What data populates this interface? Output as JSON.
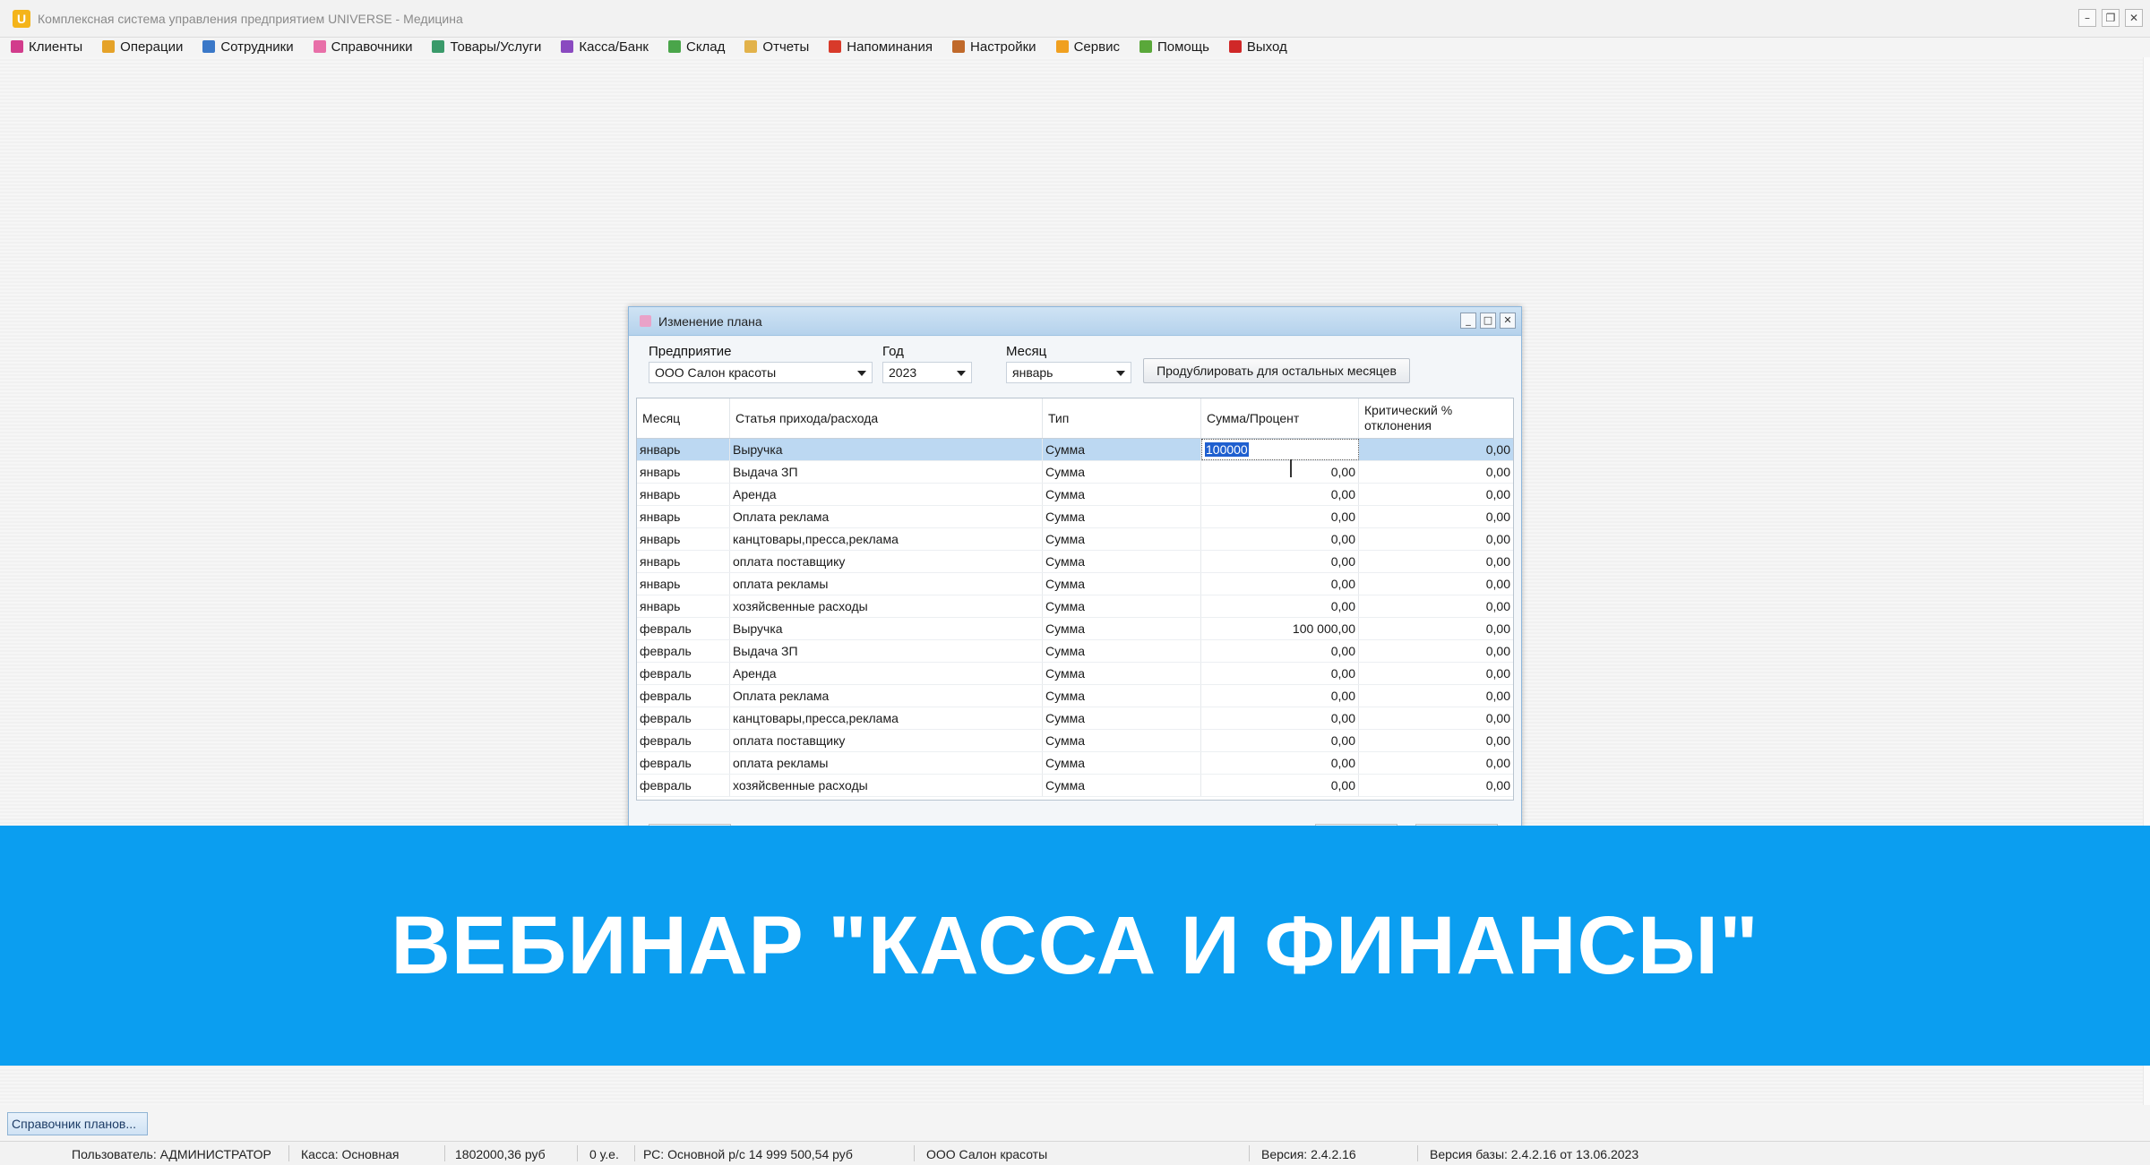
{
  "window": {
    "title": "Комплексная система управления предприятием UNIVERSE - Медицина",
    "logo_letter": "U",
    "controls": [
      "–",
      "❐",
      "✕"
    ]
  },
  "menu": [
    {
      "label": "Клиенты",
      "icon": "clients-icon",
      "color": "#d23c8c"
    },
    {
      "label": "Операции",
      "icon": "operations-icon",
      "color": "#e5a228"
    },
    {
      "label": "Сотрудники",
      "icon": "employees-icon",
      "color": "#3a78c8"
    },
    {
      "label": "Справочники",
      "icon": "directories-icon",
      "color": "#e86fa8"
    },
    {
      "label": "Товары/Услуги",
      "icon": "goods-services-icon",
      "color": "#3a9a6a"
    },
    {
      "label": "Касса/Банк",
      "icon": "cash-bank-icon",
      "color": "#8a4ac0"
    },
    {
      "label": "Склад",
      "icon": "warehouse-icon",
      "color": "#4aa54a"
    },
    {
      "label": "Отчеты",
      "icon": "reports-icon",
      "color": "#e2b24a"
    },
    {
      "label": "Напоминания",
      "icon": "reminders-icon",
      "color": "#d83a2a"
    },
    {
      "label": "Настройки",
      "icon": "settings-icon",
      "color": "#c0692a"
    },
    {
      "label": "Сервис",
      "icon": "service-icon",
      "color": "#f0a020"
    },
    {
      "label": "Помощь",
      "icon": "help-icon",
      "color": "#5aa83a"
    },
    {
      "label": "Выход",
      "icon": "exit-icon",
      "color": "#d02828"
    }
  ],
  "dialog": {
    "title": "Изменение плана",
    "controls": [
      "_",
      "□",
      "✕"
    ],
    "enterprise_label": "Предприятие",
    "enterprise_value": "ООО Салон красоты",
    "year_label": "Год",
    "year_value": "2023",
    "month_label": "Месяц",
    "month_value": "январь",
    "duplicate_button": "Продублировать для остальных месяцев",
    "columns": [
      "Месяц",
      "Статья прихода/расхода",
      "Тип",
      "Сумма/Процент",
      "Критический % отклонения"
    ],
    "rows": [
      {
        "month": "январь",
        "item": "Выручка",
        "type": "Сумма",
        "amount": "100000",
        "critical": "0,00",
        "selected": true
      },
      {
        "month": "январь",
        "item": "Выдача ЗП",
        "type": "Сумма",
        "amount": "0,00",
        "critical": "0,00"
      },
      {
        "month": "январь",
        "item": "Аренда",
        "type": "Сумма",
        "amount": "0,00",
        "critical": "0,00"
      },
      {
        "month": "январь",
        "item": "Оплата реклама",
        "type": "Сумма",
        "amount": "0,00",
        "critical": "0,00"
      },
      {
        "month": "январь",
        "item": "канцтовары,пресса,реклама",
        "type": "Сумма",
        "amount": "0,00",
        "critical": "0,00"
      },
      {
        "month": "январь",
        "item": "оплата поставщику",
        "type": "Сумма",
        "amount": "0,00",
        "critical": "0,00"
      },
      {
        "month": "январь",
        "item": "оплата рекламы",
        "type": "Сумма",
        "amount": "0,00",
        "critical": "0,00"
      },
      {
        "month": "январь",
        "item": "хозяйсвенные расходы",
        "type": "Сумма",
        "amount": "0,00",
        "critical": "0,00"
      },
      {
        "month": "февраль",
        "item": "Выручка",
        "type": "Сумма",
        "amount": "100 000,00",
        "critical": "0,00"
      },
      {
        "month": "февраль",
        "item": "Выдача ЗП",
        "type": "Сумма",
        "amount": "0,00",
        "critical": "0,00"
      },
      {
        "month": "февраль",
        "item": "Аренда",
        "type": "Сумма",
        "amount": "0,00",
        "critical": "0,00"
      },
      {
        "month": "февраль",
        "item": "Оплата реклама",
        "type": "Сумма",
        "amount": "0,00",
        "critical": "0,00"
      },
      {
        "month": "февраль",
        "item": "канцтовары,пресса,реклама",
        "type": "Сумма",
        "amount": "0,00",
        "critical": "0,00"
      },
      {
        "month": "февраль",
        "item": "оплата поставщику",
        "type": "Сумма",
        "amount": "0,00",
        "critical": "0,00"
      },
      {
        "month": "февраль",
        "item": "оплата рекламы",
        "type": "Сумма",
        "amount": "0,00",
        "critical": "0,00"
      },
      {
        "month": "февраль",
        "item": "хозяйсвенные расходы",
        "type": "Сумма",
        "amount": "0,00",
        "critical": "0,00"
      }
    ]
  },
  "banner": {
    "text": "ВЕБИНАР \"КАССА И ФИНАНСЫ\"",
    "color": "#0b9ef0"
  },
  "taskbar": {
    "item": "Справочник планов..."
  },
  "status": {
    "user": "Пользователь: АДМИНИСТРАТОР",
    "cashbox": "Касса: Основная",
    "cash_amount": "1802000,36 руб",
    "ue": "0 у.е.",
    "account": "РС: Основной р/с 14 999 500,54 руб",
    "company": "ООО Салон красоты",
    "version": "Версия: 2.4.2.16",
    "db_version": "Версия базы: 2.4.2.16 от 13.06.2023"
  }
}
